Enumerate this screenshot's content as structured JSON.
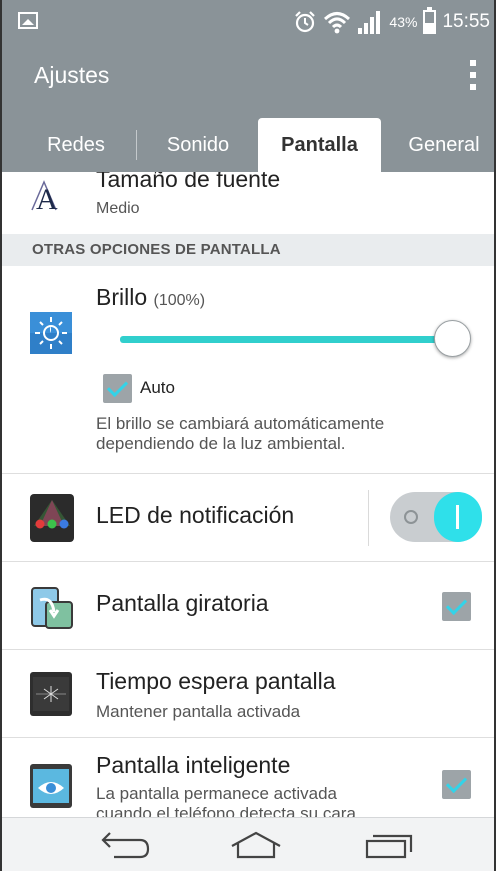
{
  "status_bar": {
    "battery_percent": "43%",
    "time": "15:55",
    "icons": [
      "gallery-icon",
      "alarm-icon",
      "wifi-icon",
      "signal-icon",
      "battery-icon"
    ]
  },
  "app_bar": {
    "title": "Ajustes",
    "menu_icon": "overflow-menu-icon"
  },
  "tabs": [
    {
      "label": "Redes",
      "active": false
    },
    {
      "label": "Sonido",
      "active": false
    },
    {
      "label": "Pantalla",
      "active": true
    },
    {
      "label": "General",
      "active": false
    }
  ],
  "settings": {
    "font_size": {
      "title": "Tamaño de fuente",
      "value": "Medio"
    },
    "section_header": "OTRAS OPCIONES DE PANTALLA",
    "brightness": {
      "title": "Brillo",
      "percent_label": "(100%)",
      "level": 1.0,
      "auto_label": "Auto",
      "auto_checked": true,
      "description_line1": "El brillo se cambiará automáticamente",
      "description_line2": "dependiendo de la luz ambiental."
    },
    "led": {
      "title": "LED de notificación",
      "enabled": true
    },
    "rotation": {
      "title": "Pantalla giratoria",
      "checked": true
    },
    "timeout": {
      "title": "Tiempo espera pantalla",
      "subtitle": "Mantener pantalla activada"
    },
    "smart_screen": {
      "title": "Pantalla inteligente",
      "subtitle_line1": "La pantalla permanece activada",
      "subtitle_line2": "cuando el teléfono detecta su cara",
      "checked": true
    }
  },
  "colors": {
    "header_bg": "#8a9398",
    "accent": "#31cfcd",
    "toggle_on": "#2fe0ea"
  },
  "nav_bar": [
    "back-icon",
    "home-icon",
    "recents-icon"
  ]
}
